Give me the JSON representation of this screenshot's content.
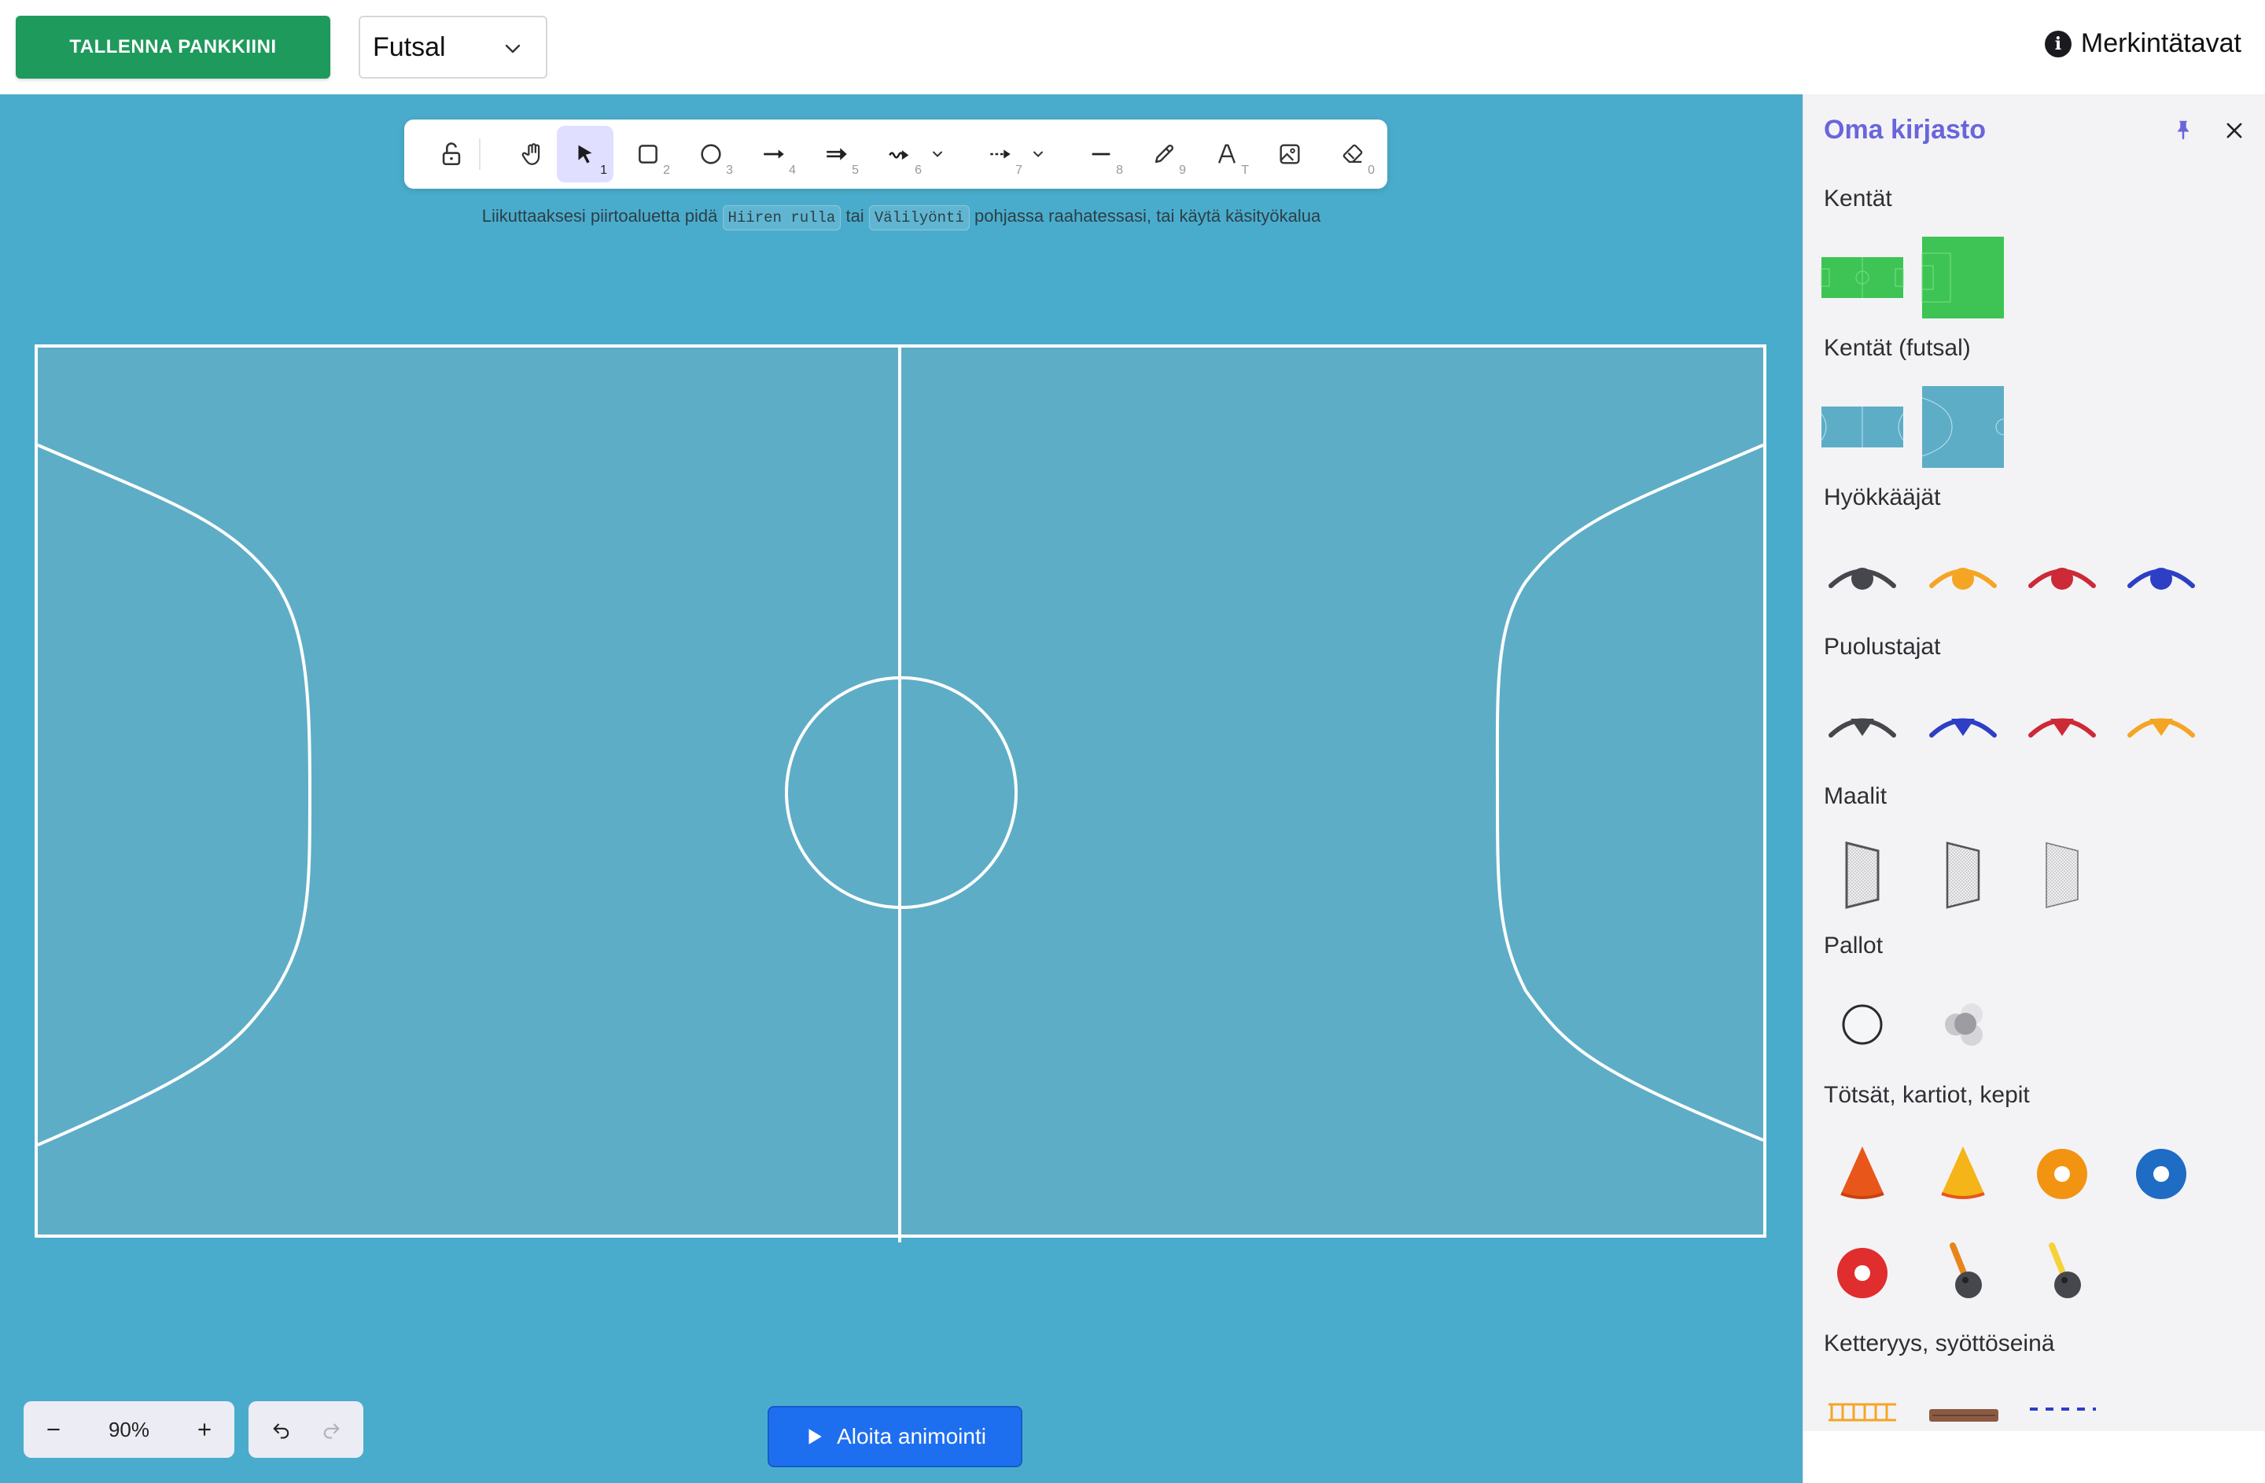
{
  "topbar": {
    "save_label": "TALLENNA PANKKIINI",
    "field_select": {
      "value": "Futsal"
    },
    "legend_label": "Merkintätavat",
    "icons": [
      "info-icon",
      "chevron-down-icon"
    ]
  },
  "toolbar": {
    "tools": [
      {
        "name": "lock",
        "icon": "lock-open-icon",
        "key": ""
      },
      {
        "name": "hand",
        "icon": "hand-icon",
        "key": ""
      },
      {
        "name": "select",
        "icon": "pointer-icon",
        "key": "1",
        "active": true
      },
      {
        "name": "rectangle",
        "icon": "square-icon",
        "key": "2"
      },
      {
        "name": "ellipse",
        "icon": "circle-icon",
        "key": "3"
      },
      {
        "name": "arrow",
        "icon": "arrow-icon",
        "key": "4"
      },
      {
        "name": "double-arrow",
        "icon": "double-arrow-icon",
        "key": "5"
      },
      {
        "name": "wavy-arrow",
        "icon": "wavy-arrow-icon",
        "key": "6"
      },
      {
        "name": "dashed-arrow",
        "icon": "dashed-arrow-icon",
        "key": "7"
      },
      {
        "name": "line",
        "icon": "line-icon",
        "key": "8"
      },
      {
        "name": "pencil",
        "icon": "pencil-icon",
        "key": "9"
      },
      {
        "name": "text",
        "icon": "text-icon",
        "key": "T"
      },
      {
        "name": "image",
        "icon": "image-icon",
        "key": ""
      },
      {
        "name": "eraser",
        "icon": "eraser-icon",
        "key": "0"
      }
    ]
  },
  "hint": {
    "prefix": "Liikuttaaksesi piirtoaluetta pidä",
    "key1": "Hiiren rulla",
    "middle": "tai",
    "key2": "Välilyönti",
    "suffix": "pohjassa raahatessasi, tai käytä käsityökalua"
  },
  "zoom": {
    "value": "90%"
  },
  "animate": {
    "label": "Aloita animointi"
  },
  "library": {
    "title": "Oma kirjasto",
    "sections": [
      {
        "label": "Kentät"
      },
      {
        "label": "Kentät (futsal)"
      },
      {
        "label": "Hyökkääjät"
      },
      {
        "label": "Puolustajat"
      },
      {
        "label": "Maalit"
      },
      {
        "label": "Pallot"
      },
      {
        "label": "Tötsät, kartiot, kepit"
      },
      {
        "label": "Ketteryys, syöttöseinä"
      }
    ]
  },
  "colors": {
    "save_green": "#1e9a5c",
    "canvas_blue": "#4aaccc",
    "field_fill": "#5eadc7",
    "accent_purple": "#6965db",
    "animate_blue": "#1e6ff0",
    "player_dark": "#45474d",
    "player_yellow": "#f5a524",
    "player_red": "#cc2a36",
    "player_blue": "#2d3fc4"
  }
}
